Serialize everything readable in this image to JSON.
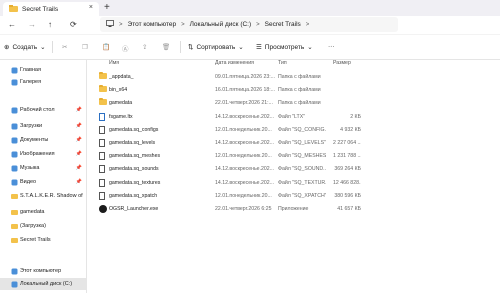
{
  "tab": {
    "title": "Secret Trails",
    "close": "×"
  },
  "newtab": "+",
  "nav": {
    "back": "←",
    "forward": "→",
    "up": "↑",
    "refresh": "⟳"
  },
  "breadcrumb": [
    "Этот компьютер",
    "Локальный диск (C:)",
    "Secret Trails"
  ],
  "breadcrumb_sep": ">",
  "commands": {
    "create": "Создать",
    "sort": "Сортировать",
    "view": "Просмотреть",
    "more": "···"
  },
  "columns": {
    "name": "Имя",
    "date": "Дата изменения",
    "type": "Тип",
    "size": "Размер"
  },
  "sidebar": {
    "items": [
      {
        "label": "Главная",
        "icon": "home-icon"
      },
      {
        "label": "Галерея",
        "icon": "gallery-icon"
      },
      {
        "label": "Рабочий стол",
        "icon": "desktop-icon",
        "pin": "📌"
      },
      {
        "label": "Загрузки",
        "icon": "downloads-icon",
        "pin": "📌"
      },
      {
        "label": "Документы",
        "icon": "documents-icon",
        "pin": "📌"
      },
      {
        "label": "Изображения",
        "icon": "pictures-icon",
        "pin": "📌"
      },
      {
        "label": "Музыка",
        "icon": "music-icon",
        "pin": "📌"
      },
      {
        "label": "Видео",
        "icon": "videos-icon",
        "pin": "📌"
      },
      {
        "label": "S.T.A.L.K.E.R. Shadow of Che",
        "icon": "folder-icon"
      },
      {
        "label": "gamedata",
        "icon": "folder-icon"
      },
      {
        "label": "(Загрузка)",
        "icon": "folder-icon"
      },
      {
        "label": "Secret Trails",
        "icon": "folder-icon"
      },
      {
        "label": "Этот компьютер",
        "icon": "computer-icon"
      },
      {
        "label": "Локальный диск (C:)",
        "icon": "drive-icon"
      }
    ]
  },
  "files": [
    {
      "name": "_appdata_",
      "date": "09.01.пятница.2026 23:...",
      "type": "Папка с файлами",
      "size": "",
      "icon": "folder"
    },
    {
      "name": "bin_x64",
      "date": "16.01.пятница.2026 18:...",
      "type": "Папка с файлами",
      "size": "",
      "icon": "folder"
    },
    {
      "name": "gamedata",
      "date": "22.01.четверг.2026 21:...",
      "type": "Папка с файлами",
      "size": "",
      "icon": "folder"
    },
    {
      "name": "fsgame.ltx",
      "date": "14.12.воскресенье.202...",
      "type": "Файл \"LTX\"",
      "size": "2 КБ",
      "icon": "txt"
    },
    {
      "name": "gamedata.sq_configs",
      "date": "12.01.понедельник.20...",
      "type": "Файл \"SQ_CONFIG...",
      "size": "4 932 КБ",
      "icon": "doc"
    },
    {
      "name": "gamedata.sq_levels",
      "date": "14.12.воскресенье.202...",
      "type": "Файл \"SQ_LEVELS\"",
      "size": "2 227 064 ...",
      "icon": "doc"
    },
    {
      "name": "gamedata.sq_meshes",
      "date": "12.01.понедельник.20...",
      "type": "Файл \"SQ_MESHES\"",
      "size": "1 231 788 ...",
      "icon": "doc"
    },
    {
      "name": "gamedata.sq_sounds",
      "date": "14.12.воскресенье.202...",
      "type": "Файл \"SQ_SOUND...",
      "size": "369 264 КБ",
      "icon": "doc"
    },
    {
      "name": "gamedata.sq_textures",
      "date": "14.12.воскресенье.202...",
      "type": "Файл \"SQ_TEXTUR...",
      "size": "12 466 828...",
      "icon": "doc"
    },
    {
      "name": "gamedata.sq_xpatch",
      "date": "12.01.понедельник.20...",
      "type": "Файл \"SQ_XPATCH\"",
      "size": "380 596 КБ",
      "icon": "doc"
    },
    {
      "name": "OGSR_Launcher.exe",
      "date": "22.01.четверг.2026 6:25",
      "type": "Приложение",
      "size": "41 657 КБ",
      "icon": "exe"
    }
  ]
}
